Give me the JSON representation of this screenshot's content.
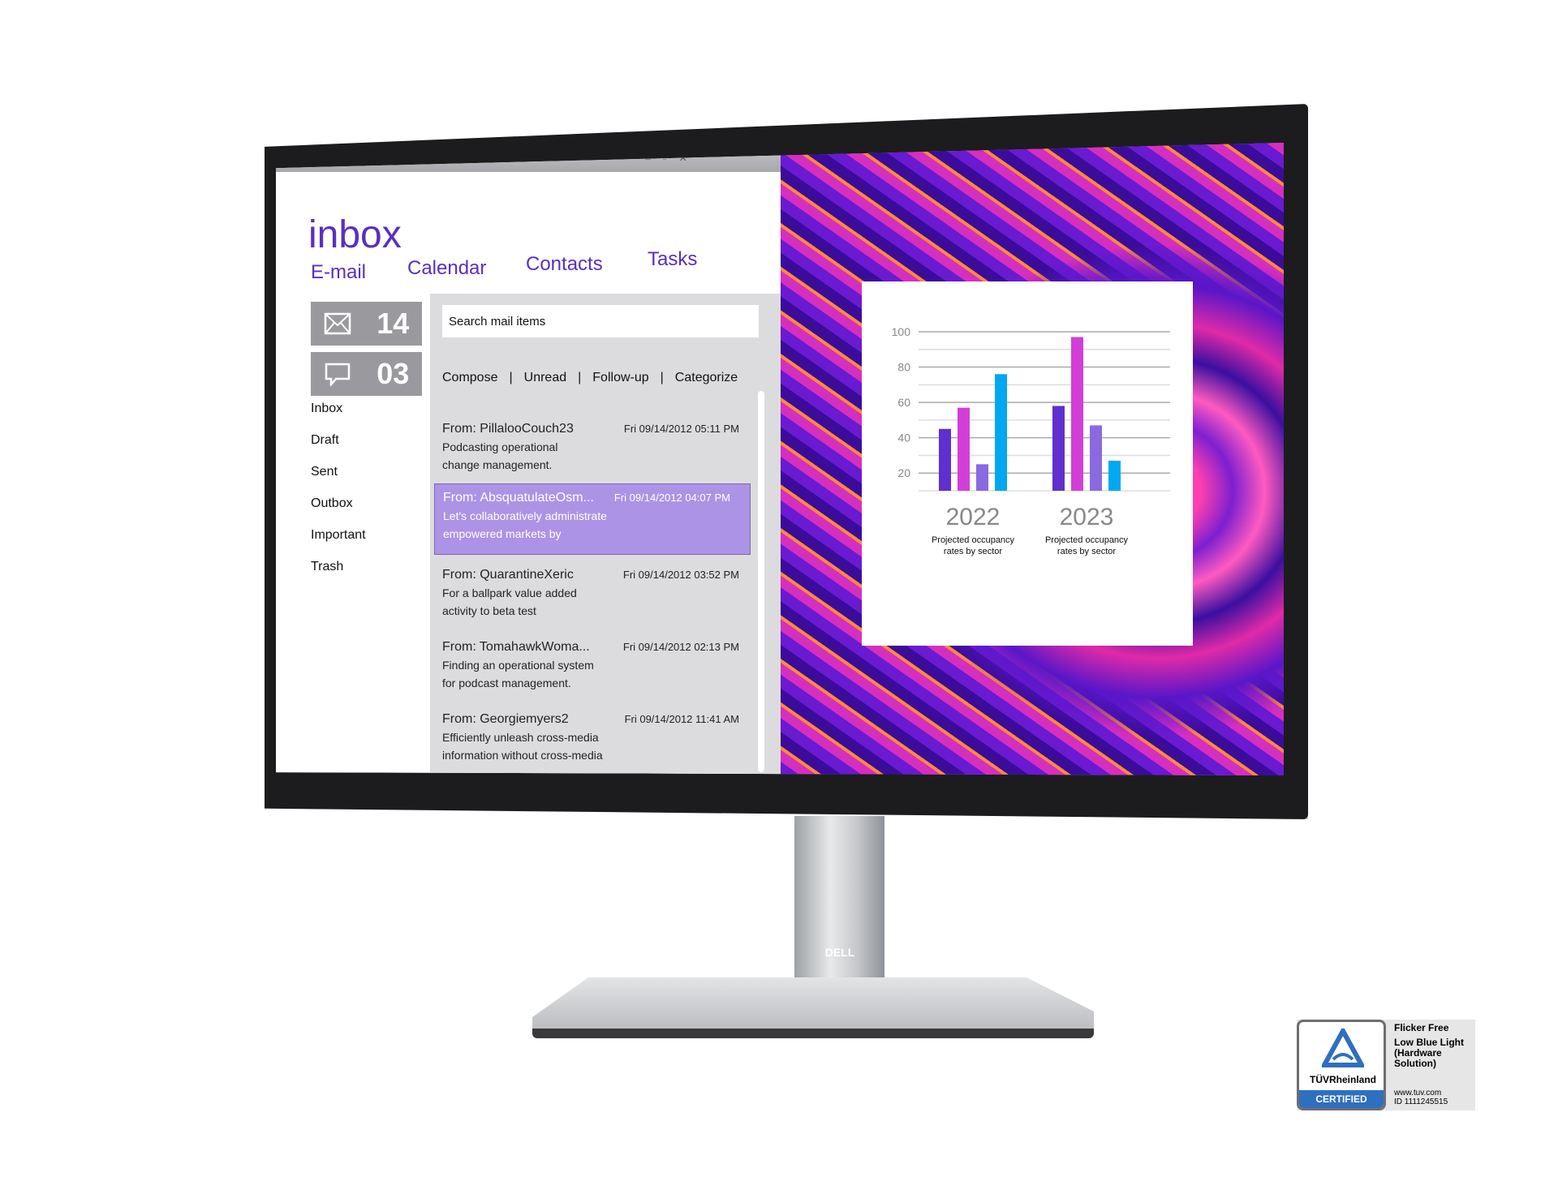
{
  "app": {
    "title": "inbox",
    "tabs": [
      "E-mail",
      "Calendar",
      "Contacts",
      "Tasks"
    ],
    "window_controls": "– ▫ ✕"
  },
  "counters": [
    {
      "icon": "envelope-icon",
      "value": "14"
    },
    {
      "icon": "chat-bubble-icon",
      "value": "03"
    }
  ],
  "folders": [
    "Inbox",
    "Draft",
    "Sent",
    "Outbox",
    "Important",
    "Trash"
  ],
  "search": {
    "placeholder": "Search mail items"
  },
  "toolbar": {
    "items": [
      "Compose",
      "Unread",
      "Follow-up",
      "Categorize"
    ],
    "separator": "|"
  },
  "emails": [
    {
      "from": "From: PillalooCouch23",
      "date": "Fri 09/14/2012 05:11 PM",
      "line1": "Podcasting operational",
      "line2": "change management.",
      "selected": false
    },
    {
      "from": "From: AbsquatulateOsm...",
      "date": "Fri 09/14/2012 04:07 PM",
      "line1": "Let's collaboratively administrate",
      "line2": "empowered markets by",
      "selected": true
    },
    {
      "from": "From: QuarantineXeric",
      "date": "Fri 09/14/2012 03:52 PM",
      "line1": "For a ballpark value added",
      "line2": "activity to beta test",
      "selected": false
    },
    {
      "from": "From: TomahawkWoma...",
      "date": "Fri 09/14/2012 02:13 PM",
      "line1": "Finding an operational system",
      "line2": "for podcast management.",
      "selected": false
    },
    {
      "from": "From: Georgiemyers2",
      "date": "Fri 09/14/2012 11:41 AM",
      "line1": "Efficiently unleash cross-media",
      "line2": "information without cross-media",
      "selected": false
    }
  ],
  "colors": {
    "accent": "#5a2fc0",
    "selected_row": "#ad93e6",
    "bar_colors": [
      "#5f2fd0",
      "#d23fd8",
      "#8a6ae0",
      "#00a8f0"
    ]
  },
  "chart_data": {
    "type": "bar",
    "categories": [
      "2022",
      "2023"
    ],
    "category_captions": [
      "Projected occupancy rates by sector",
      "Projected occupancy rates by sector"
    ],
    "series": [
      {
        "values": [
          45,
          58
        ]
      },
      {
        "values": [
          57,
          97
        ]
      },
      {
        "values": [
          25,
          47
        ]
      },
      {
        "values": [
          76,
          27
        ]
      }
    ],
    "yticks": [
      20,
      40,
      60,
      80,
      100
    ],
    "ylim": [
      10,
      100
    ],
    "grid": true
  },
  "brand": "DELL",
  "badge": {
    "org": "TÜVRheinland",
    "status": "CERTIFIED",
    "features": [
      "Flicker Free",
      "Low Blue Light",
      "(Hardware",
      "Solution)"
    ],
    "url": "www.tuv.com",
    "id": "ID 1111245515"
  }
}
